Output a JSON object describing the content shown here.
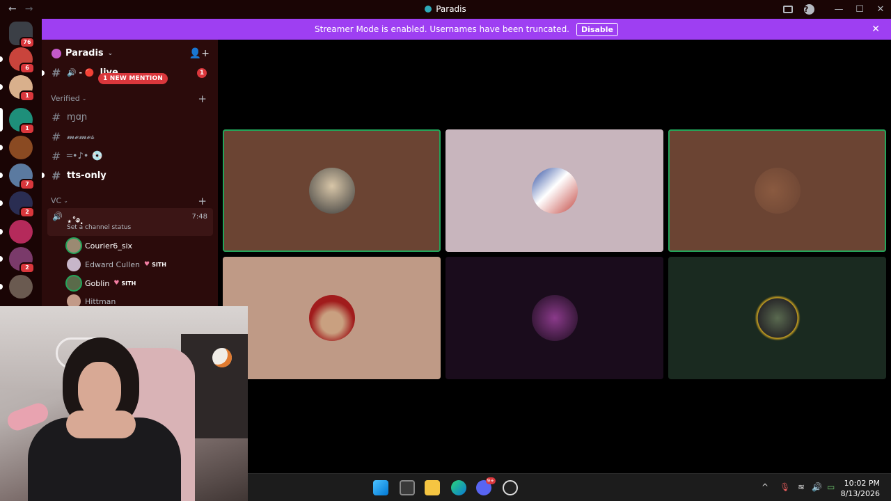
{
  "window": {
    "title": "Paradis",
    "back": "←",
    "forward": "→",
    "help": "?",
    "minimize": "—",
    "maximize": "☐",
    "close": "✕"
  },
  "banner": {
    "text": "Streamer Mode is enabled. Usernames have been truncated.",
    "disable_label": "Disable",
    "close": "✕"
  },
  "guilds": [
    {
      "name": "discord-home",
      "badge": "76",
      "color": "#3b3f46"
    },
    {
      "name": "server-2",
      "badge": "6",
      "color": "#c9443c"
    },
    {
      "name": "server-3",
      "badge": "1",
      "color": "#d9b08c"
    },
    {
      "name": "server-4",
      "badge": "1",
      "color": "#1e8f7a"
    },
    {
      "name": "server-5",
      "badge": "",
      "color": "#8a4a22"
    },
    {
      "name": "server-6",
      "badge": "7",
      "color": "#5b7aa0"
    },
    {
      "name": "server-7",
      "badge": "2",
      "color": "#2a2d52"
    },
    {
      "name": "server-8",
      "badge": "",
      "color": "#b52a5b"
    },
    {
      "name": "server-9",
      "badge": "2",
      "color": "#7a3a6a"
    },
    {
      "name": "server-10",
      "badge": "",
      "color": "#6a5a50"
    }
  ],
  "server": {
    "name": "Paradis",
    "chevron": "⌄"
  },
  "channels": {
    "top": {
      "name": "live",
      "prefix": "🔊 - 🔴"
    },
    "new_mention": "1 NEW MENTION",
    "mention_count": "1",
    "verified_category": "Verified",
    "verified": [
      {
        "name": "ɱɑɲ"
      },
      {
        "name": "𝓶𝓮𝓶𝓮𝓼"
      },
      {
        "name": "═•♪• 💿"
      },
      {
        "name": "tts-only"
      }
    ],
    "vc_category": "VC",
    "voice": {
      "name": "⋆˚࿔.",
      "status": "Set a channel status",
      "time": "7:48"
    },
    "users": [
      {
        "name": "Courier6_six",
        "tag": "",
        "color": "#9b8a72"
      },
      {
        "name": "Edward Cullen",
        "tag": "SITH",
        "color": "#c7b6c9"
      },
      {
        "name": "Goblin",
        "tag": "SITH",
        "color": "#5a6b4a"
      },
      {
        "name": "Hittman",
        "tag": "",
        "color": "#c29a88"
      }
    ]
  },
  "tiles": [
    {
      "bg": "#6b4433",
      "pic": "#c9b59a",
      "speaking": true
    },
    {
      "bg": "#c8b5bd",
      "pic": "#c44a44",
      "speaking": false
    },
    {
      "bg": "#6b4433",
      "pic": "#7a4c36",
      "speaking": true
    },
    {
      "bg": "#bf9a86",
      "pic": "#a11c1c",
      "speaking": false
    },
    {
      "bg": "#1a0c1c",
      "pic": "#6a2a6a",
      "speaking": false
    },
    {
      "bg": "#1a2a20",
      "pic": "#3a4a3a",
      "speaking": false
    }
  ],
  "taskbar": {
    "discord_badge": "9+",
    "tray_chevron": "^",
    "time": "10:02 PM",
    "date": "8/13/2026"
  }
}
